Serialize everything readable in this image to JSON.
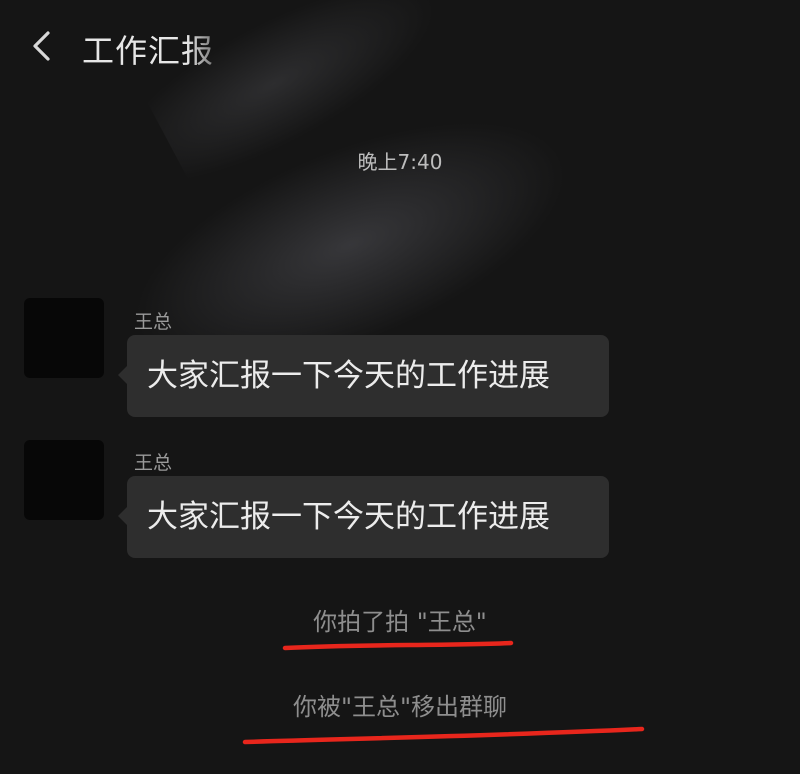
{
  "header": {
    "title": "工作汇报",
    "back_icon": "chevron-left-icon"
  },
  "chat": {
    "timestamp": "晚上7:40",
    "messages": [
      {
        "sender": "王总",
        "text": "大家汇报一下今天的工作进展"
      },
      {
        "sender": "王总",
        "text": "大家汇报一下今天的工作进展"
      }
    ],
    "system_messages": [
      "你拍了拍 \"王总\"",
      "你被\"王总\"移出群聊"
    ]
  },
  "colors": {
    "background": "#151515",
    "bubble": "#2e2e2e",
    "annotation_underline": "#e8261c"
  }
}
